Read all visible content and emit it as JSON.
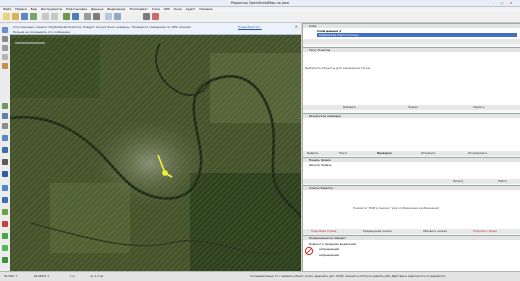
{
  "window": {
    "title": "Редактор OpenStreetMap на Java",
    "controls": [
      "–",
      "□",
      "✕"
    ]
  },
  "menu": [
    "Файл",
    "Правка",
    "Вид",
    "Инструменты",
    "Подстыковка",
    "Данные",
    "Выделение",
    "Тэгоподмет",
    "Слои",
    "GPS",
    "Окна",
    "Аудит",
    "Справка"
  ],
  "notice": {
    "text": "Спутниковые снимки \"DigitalGlobe Premium Images\" может быть неверны. Проверьте смещение по GPS-трекам!",
    "checkbox_label": "Больше не показывать это сообщение",
    "link": "Подробности..."
  },
  "layers": {
    "header": "Слои",
    "item1": "Слой данных 1",
    "item2": "DigitalGlobe Premium Imag..."
  },
  "tags": {
    "header": "Теги / Участие",
    "empty": "Выберите объекты для изменения тегов.",
    "buttons": [
      "Добавить",
      "Правка",
      "Удалить"
    ]
  },
  "validation": {
    "header": "Результаты проверки",
    "buttons": [
      "Выбрать",
      "Поиск",
      "Проверка",
      "Исправить",
      "Игнорировать"
    ]
  },
  "filters": {
    "header1": "Панель правок",
    "header2": "Фильтр Правок",
    "filter_buttons": [
      "Фильтр",
      "Найти"
    ]
  },
  "notes": {
    "header": "Список Заметок",
    "empty": "Нажмите \"OSM в Снимок\" для отображения изображений",
    "buttons": [
      "Подробнее справа",
      "Предыдущий снимок",
      "Обновить снимки",
      "Подробно справа"
    ]
  },
  "preset": {
    "header": "Ограничения на поворот",
    "subheader": "Поворот в пределах выделения",
    "row1": "запрещающий",
    "row2": "запрещающий"
  },
  "statusbar": {
    "lat": "56.3041 7",
    "lon": "60.06451 3",
    "text": "последовательно от  = выбрать объект (клик), выделить доп. (Shift), изменить (Ctrl) или удалить (Alt). Действие в зависимости от видимости.",
    "zoom": "1 м",
    "size": "ca. 1.7 км"
  },
  "icons": {
    "leftbar": [
      "pointer-icon",
      "zoom-icon",
      "draw-icon",
      "lasso-icon",
      "hand-icon",
      "delete-icon",
      "layer-icon"
    ],
    "toolbar": [
      "new-icon",
      "open-icon",
      "save-icon",
      "export-icon",
      "undo-icon",
      "redo-icon",
      "upload-icon",
      "download-icon",
      "preferences-icon",
      "wireframe-icon",
      "search-icon",
      "info-icon",
      "print-icon",
      "help-icon"
    ]
  }
}
